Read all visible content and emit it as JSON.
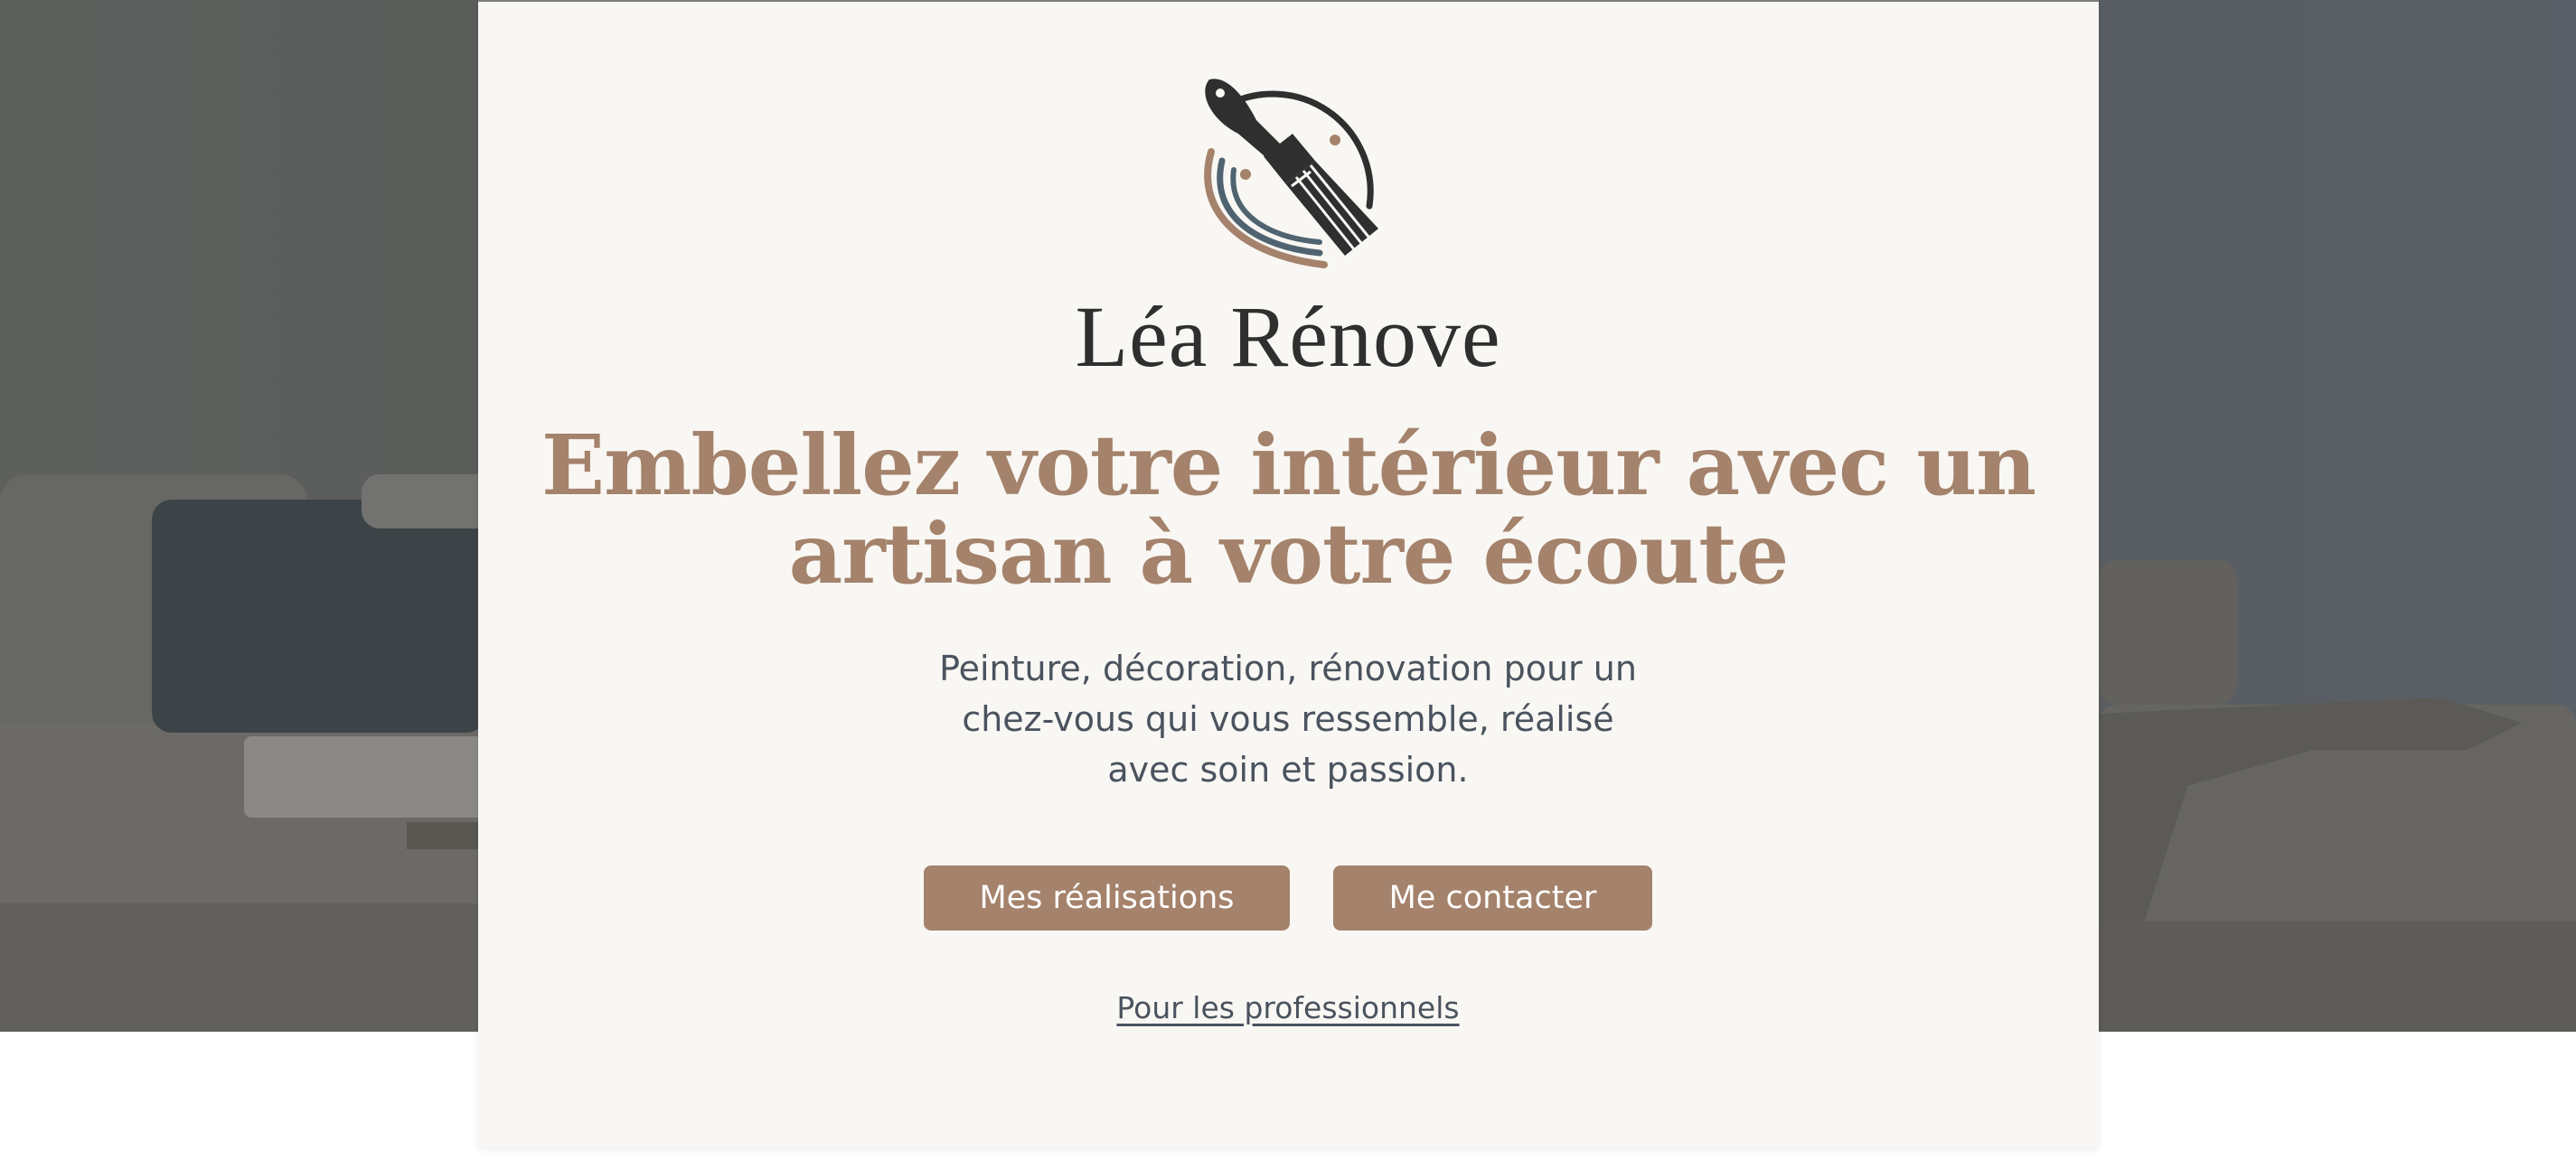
{
  "brand": {
    "name": "Léa Rénove",
    "logo_icon": "paintbrush-logo-icon"
  },
  "hero": {
    "headline": "Embellez votre intérieur avec un artisan à votre écoute",
    "subtitle": "Peinture, décoration, rénovation pour un chez-vous qui vous ressemble, réalisé avec soin et passion.",
    "background_image": "living-room-sofa-photo"
  },
  "actions": {
    "portfolio_label": "Mes réalisations",
    "contact_label": "Me contacter",
    "pro_link_label": "Pour les professionnels"
  },
  "colors": {
    "accent": "#a4826b",
    "card_background": "#f9f7f3",
    "text_dark": "#2f2f2f",
    "text_muted": "#4a535e",
    "brush_teal": "#4f6470"
  }
}
